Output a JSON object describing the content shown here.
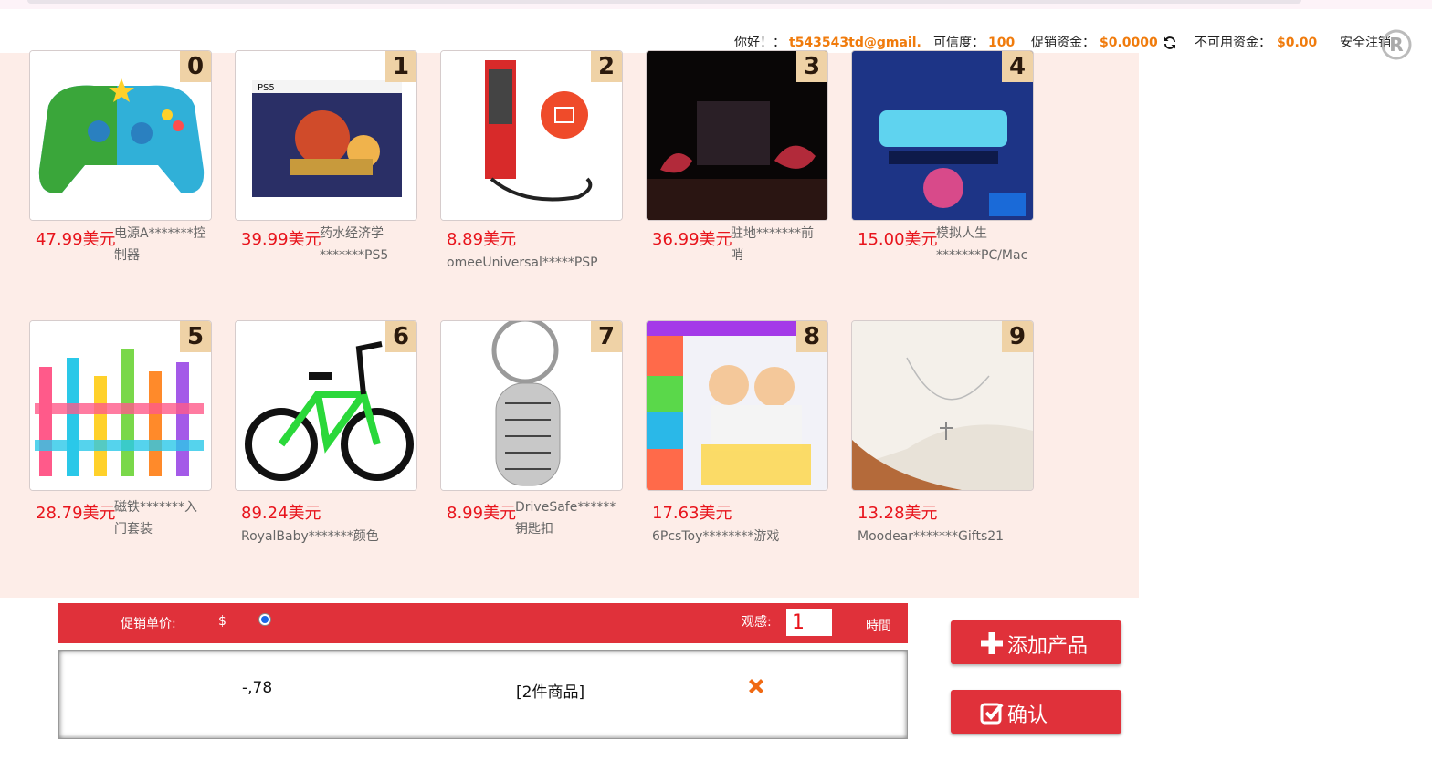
{
  "header": {
    "greeting": "你好！：",
    "email": "t543543td@gmail.",
    "credit_label": "可信度：",
    "credit_value": "100",
    "promo_funds_label": "促销资金：",
    "promo_funds_value": "$0.0000",
    "unavailable_label": "不可用资金：",
    "unavailable_value": "$0.00",
    "logout": "安全注销"
  },
  "products": [
    {
      "index": "0",
      "price": "47.99美元",
      "name": "电源A*******控制器"
    },
    {
      "index": "1",
      "price": "39.99美元",
      "name": "药水经济学*******PS5"
    },
    {
      "index": "2",
      "price": "8.89美元",
      "name": "omeeUniversal*****PSP"
    },
    {
      "index": "3",
      "price": "36.99美元",
      "name": "驻地*******前哨"
    },
    {
      "index": "4",
      "price": "15.00美元",
      "name": "模拟人生*******PC/Mac"
    },
    {
      "index": "5",
      "price": "28.79美元",
      "name": "磁铁*******入门套装"
    },
    {
      "index": "6",
      "price": "89.24美元",
      "name": "RoyalBaby*******颜色"
    },
    {
      "index": "7",
      "price": "8.99美元",
      "name": "DriveSafe******钥匙扣"
    },
    {
      "index": "8",
      "price": "17.63美元",
      "name": "6PcsToy********游戏"
    },
    {
      "index": "9",
      "price": "13.28美元",
      "name": "Moodear*******Gifts21"
    }
  ],
  "product_text_lines": [
    [
      "电源A*******控",
      "制器"
    ],
    [
      "药水经济学",
      "*******PS5"
    ],
    [
      "omeeUniversal*****PSP"
    ],
    [
      "驻地*******前",
      "哨"
    ],
    [
      "模拟人生",
      "*******PC/Mac"
    ],
    [
      "磁铁*******入",
      "门套装"
    ],
    [
      "RoyalBaby*******颜色"
    ],
    [
      "DriveSafe******",
      "钥匙扣"
    ],
    [
      "6PcsToy********游戏"
    ],
    [
      "Moodear*******Gifts21"
    ]
  ],
  "order_bar": {
    "unit_price_label": "促销单价:",
    "currency": "$",
    "views_label": "观感:",
    "quantity_value": "1",
    "time_label": "時間"
  },
  "selection": {
    "value": "-,78",
    "items": "[2件商品]"
  },
  "buttons": {
    "add_product": "添加产品",
    "confirm": "确认"
  },
  "colors": {
    "accent_red": "#e0313a",
    "price_red": "#e8141c",
    "highlight_orange": "#f07b0c",
    "panel_bg": "#fdede8"
  }
}
